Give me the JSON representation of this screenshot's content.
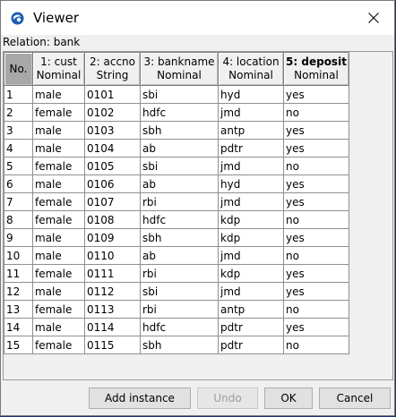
{
  "window": {
    "title": "Viewer"
  },
  "relation": {
    "text": "Relation: bank"
  },
  "columns": [
    {
      "name": "No.",
      "type": ""
    },
    {
      "name": "1: cust",
      "type": "Nominal"
    },
    {
      "name": "2: accno",
      "type": "String"
    },
    {
      "name": "3: bankname",
      "type": "Nominal"
    },
    {
      "name": "4: location",
      "type": "Nominal"
    },
    {
      "name": "5: deposit",
      "type": "Nominal"
    }
  ],
  "rows": [
    [
      "1",
      "male",
      "0101",
      "sbi",
      "hyd",
      "yes"
    ],
    [
      "2",
      "female",
      "0102",
      "hdfc",
      "jmd",
      "no"
    ],
    [
      "3",
      "male",
      "0103",
      "sbh",
      "antp",
      "yes"
    ],
    [
      "4",
      "male",
      "0104",
      "ab",
      "pdtr",
      "yes"
    ],
    [
      "5",
      "female",
      "0105",
      "sbi",
      "jmd",
      "no"
    ],
    [
      "6",
      "male",
      "0106",
      "ab",
      "hyd",
      "yes"
    ],
    [
      "7",
      "female",
      "0107",
      "rbi",
      "jmd",
      "yes"
    ],
    [
      "8",
      "female",
      "0108",
      "hdfc",
      "kdp",
      "no"
    ],
    [
      "9",
      "male",
      "0109",
      "sbh",
      "kdp",
      "yes"
    ],
    [
      "10",
      "male",
      "0110",
      "ab",
      "jmd",
      "no"
    ],
    [
      "11",
      "female",
      "0111",
      "rbi",
      "kdp",
      "yes"
    ],
    [
      "12",
      "male",
      "0112",
      "sbi",
      "jmd",
      "yes"
    ],
    [
      "13",
      "female",
      "0113",
      "rbi",
      "antp",
      "no"
    ],
    [
      "14",
      "male",
      "0114",
      "hdfc",
      "pdtr",
      "yes"
    ],
    [
      "15",
      "female",
      "0115",
      "sbh",
      "pdtr",
      "no"
    ]
  ],
  "buttons": {
    "add_instance": "Add instance",
    "undo": "Undo",
    "ok": "OK",
    "cancel": "Cancel"
  },
  "icons": {
    "app": "weka-app-icon",
    "close": "close-icon"
  }
}
